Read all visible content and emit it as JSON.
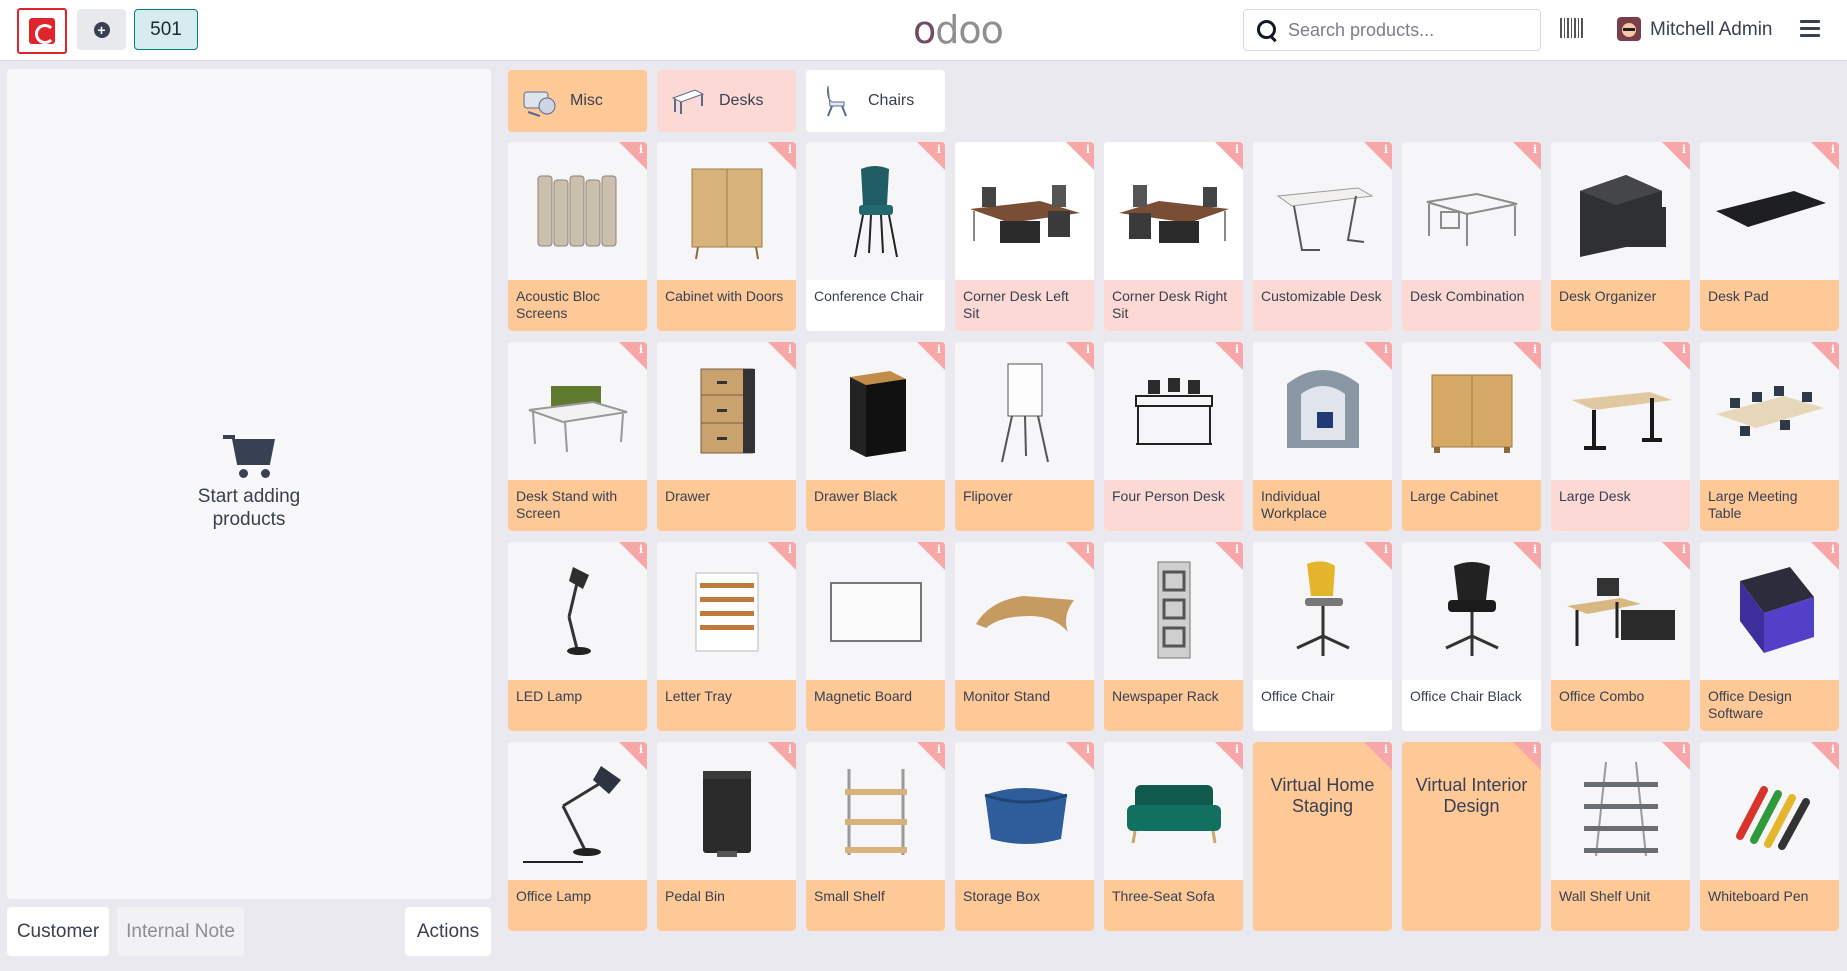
{
  "navbar": {
    "order_number": "501",
    "brand": "odoo",
    "search_placeholder": "Search products...",
    "user_name": "Mitchell Admin"
  },
  "order_pane": {
    "empty_message": "Start adding products"
  },
  "bottom_buttons": {
    "customer": "Customer",
    "internal_note": "Internal Note",
    "actions": "Actions"
  },
  "categories": [
    {
      "label": "Misc"
    },
    {
      "label": "Desks"
    },
    {
      "label": "Chairs"
    }
  ],
  "products": [
    {
      "name": "Acoustic Bloc Screens",
      "icon": "screen-icon"
    },
    {
      "name": "Cabinet with Doors",
      "icon": "cabinet-icon"
    },
    {
      "name": "Conference Chair",
      "icon": "chair-icon"
    },
    {
      "name": "Corner Desk Left Sit",
      "icon": "desk-icon"
    },
    {
      "name": "Corner Desk Right Sit",
      "icon": "desk-icon"
    },
    {
      "name": "Customizable Desk",
      "icon": "table-icon"
    },
    {
      "name": "Desk Combination",
      "icon": "desk-combo-icon"
    },
    {
      "name": "Desk Organizer",
      "icon": "organizer-icon"
    },
    {
      "name": "Desk Pad",
      "icon": "pad-icon"
    },
    {
      "name": "Desk Stand with Screen",
      "icon": "desk-stand-icon"
    },
    {
      "name": "Drawer",
      "icon": "drawer-icon"
    },
    {
      "name": "Drawer Black",
      "icon": "drawer-black-icon"
    },
    {
      "name": "Flipover",
      "icon": "flipover-icon"
    },
    {
      "name": "Four Person Desk",
      "icon": "four-desk-icon"
    },
    {
      "name": "Individual Workplace",
      "icon": "workplace-icon"
    },
    {
      "name": "Large Cabinet",
      "icon": "large-cabinet-icon"
    },
    {
      "name": "Large Desk",
      "icon": "large-desk-icon"
    },
    {
      "name": "Large Meeting Table",
      "icon": "meeting-table-icon"
    },
    {
      "name": "LED Lamp",
      "icon": "lamp-icon"
    },
    {
      "name": "Letter Tray",
      "icon": "tray-icon"
    },
    {
      "name": "Magnetic Board",
      "icon": "board-icon"
    },
    {
      "name": "Monitor Stand",
      "icon": "stand-icon"
    },
    {
      "name": "Newspaper Rack",
      "icon": "rack-icon"
    },
    {
      "name": "Office Chair",
      "icon": "office-chair-icon"
    },
    {
      "name": "Office Chair Black",
      "icon": "office-chair-black-icon"
    },
    {
      "name": "Office Combo",
      "icon": "combo-icon"
    },
    {
      "name": "Office Design Software",
      "icon": "software-box-icon"
    },
    {
      "name": "Office Lamp",
      "icon": "office-lamp-icon"
    },
    {
      "name": "Pedal Bin",
      "icon": "bin-icon"
    },
    {
      "name": "Small Shelf",
      "icon": "shelf-icon"
    },
    {
      "name": "Storage Box",
      "icon": "storage-box-icon"
    },
    {
      "name": "Three-Seat Sofa",
      "icon": "sofa-icon"
    },
    {
      "name": "Virtual Home Staging",
      "icon": ""
    },
    {
      "name": "Virtual Interior Design",
      "icon": ""
    },
    {
      "name": "Wall Shelf Unit",
      "icon": "wall-shelf-icon"
    },
    {
      "name": "Whiteboard Pen",
      "icon": "pen-icon"
    }
  ],
  "colors": {
    "misc_category": "#ffc897",
    "desks_category": "#fcd9d4",
    "chairs_category": "#ffffff",
    "info_badge": "#f7a7a7",
    "accent": "#017e84"
  }
}
